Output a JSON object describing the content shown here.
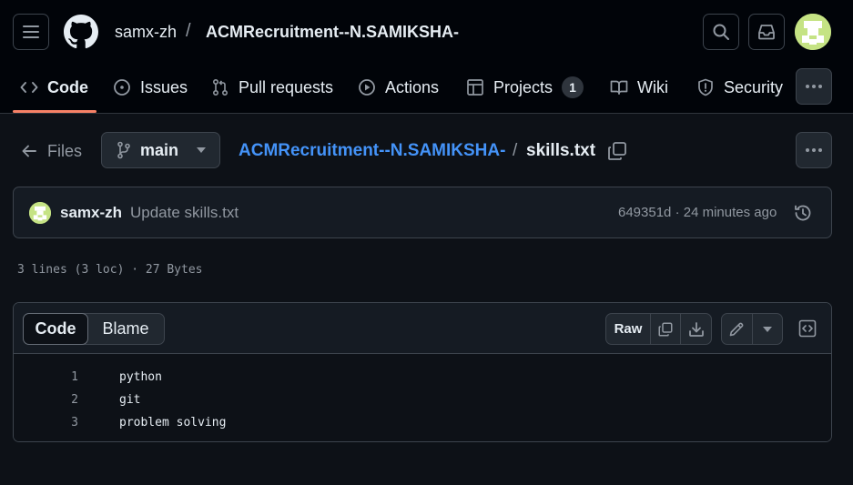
{
  "header": {
    "owner": "samx-zh",
    "separator": "/",
    "repo_name": "ACMRecruitment--N.SAMIKSHA-"
  },
  "nav": {
    "tabs": [
      {
        "label": "Code",
        "icon": "code-icon",
        "selected": true
      },
      {
        "label": "Issues",
        "icon": "issue-icon"
      },
      {
        "label": "Pull requests",
        "icon": "pull-request-icon"
      },
      {
        "label": "Actions",
        "icon": "play-icon"
      },
      {
        "label": "Projects",
        "icon": "table-icon",
        "count": "1"
      },
      {
        "label": "Wiki",
        "icon": "book-icon"
      },
      {
        "label": "Security",
        "icon": "shield-icon"
      }
    ]
  },
  "breadcrumb": {
    "files_label": "Files",
    "branch": "main",
    "repo": "ACMRecruitment--N.SAMIKSHA-",
    "separator": "/",
    "file": "skills.txt"
  },
  "commit": {
    "author": "samx-zh",
    "message": "Update skills.txt",
    "meta": "649351d · 24 minutes ago"
  },
  "file_info": "3 lines (3 loc) · 27 Bytes",
  "code_view": {
    "tabs": [
      "Code",
      "Blame"
    ],
    "raw_label": "Raw",
    "lines": [
      {
        "n": "1",
        "text": "python"
      },
      {
        "n": "2",
        "text": "git"
      },
      {
        "n": "3",
        "text": "problem solving"
      }
    ]
  },
  "colors": {
    "link": "#4493f8",
    "accent_underline": "#f78166",
    "background": "#0d1117"
  }
}
